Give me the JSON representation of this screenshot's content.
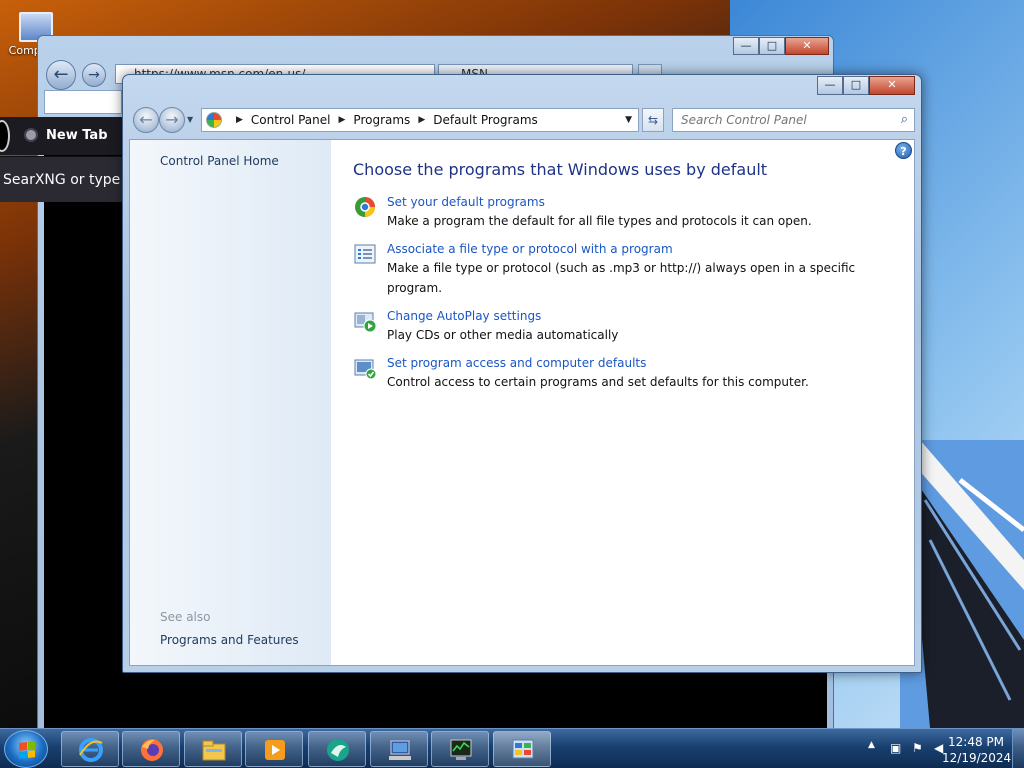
{
  "desktop": {
    "icon_label": "Computer"
  },
  "browser_background": {
    "address_text": "https://www.msn.com/en-us/...",
    "tab_title": "MSN",
    "firefox_tab_label": "New Tab",
    "firefox_url_placeholder": "SearXNG or type a URL"
  },
  "window": {
    "minimize": "—",
    "maximize": "□",
    "close": "✕"
  },
  "navbar": {
    "back_glyph": "←",
    "forward_glyph": "→",
    "breadcrumbs": [
      "Control Panel",
      "Programs",
      "Default Programs"
    ],
    "refresh_glyph": "⇆",
    "search_placeholder": "Search Control Panel"
  },
  "left_pane": {
    "home_link": "Control Panel Home",
    "see_also_heading": "See also",
    "see_also_links": [
      "Programs and Features"
    ]
  },
  "main": {
    "help_glyph": "?",
    "title": "Choose the programs that Windows uses by default",
    "tasks": [
      {
        "link": "Set your default programs",
        "description": "Make a program the default for all file types and protocols it can open.",
        "icon": "default-programs-icon"
      },
      {
        "link": "Associate a file type or protocol with a program",
        "description": "Make a file type or protocol (such as .mp3 or http://) always open in a specific program.",
        "icon": "file-association-icon"
      },
      {
        "link": "Change AutoPlay settings",
        "description": "Play CDs or other media automatically",
        "icon": "autoplay-icon"
      },
      {
        "link": "Set program access and computer defaults",
        "description": "Control access to certain programs and set defaults for this computer.",
        "icon": "program-access-icon"
      }
    ]
  },
  "taskbar": {
    "pinned": [
      "internet-explorer-icon",
      "firefox-icon",
      "file-explorer-icon",
      "media-player-icon",
      "app-icon",
      "network-icon",
      "task-manager-icon",
      "control-panel-icon"
    ],
    "clock_time": "12:48 PM",
    "clock_date": "12/19/2024",
    "tray_expand_glyph": "▲"
  },
  "colors": {
    "link": "#1a56c4",
    "title": "#1e3287",
    "taskbar": "#19406f"
  }
}
